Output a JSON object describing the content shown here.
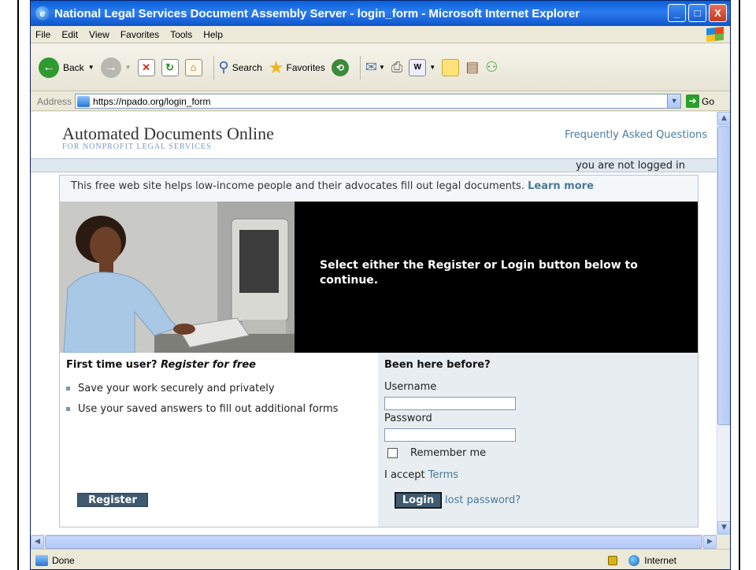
{
  "window": {
    "title": "National Legal Services Document Assembly Server - login_form - Microsoft Internet Explorer",
    "controls": [
      "_",
      "□",
      "X"
    ]
  },
  "menu": [
    "File",
    "Edit",
    "View",
    "Favorites",
    "Tools",
    "Help"
  ],
  "toolbar": {
    "back_label": "Back",
    "search_label": "Search",
    "favorites_label": "Favorites"
  },
  "address": {
    "label": "Address",
    "url": "https://npado.org/login_form",
    "go_label": "Go"
  },
  "site": {
    "title": "Automated Documents Online",
    "subtitle": "FOR NONPROFIT LEGAL SERVICES",
    "faq_link": "Frequently Asked Questions",
    "login_status": "you are not logged in",
    "intro_text": "This free web site helps low-income people and their advocates fill out legal documents.",
    "learn_more": "Learn more",
    "hero_message": "Select either the Register or Login button below to continue."
  },
  "register": {
    "heading_prefix": "First time user?",
    "heading_emph": "Register for free",
    "bullets": [
      "Save your work securely and privately",
      "Use your saved answers to fill out additional forms"
    ],
    "button": "Register"
  },
  "login": {
    "heading": "Been here before?",
    "username_label": "Username",
    "username_value": "",
    "password_label": "Password",
    "password_value": "",
    "remember_label": "Remember me",
    "remember_checked": false,
    "accept_prefix": "I accept",
    "terms_link": "Terms",
    "button": "Login",
    "lost_password": "lost password?"
  },
  "status": {
    "text": "Done",
    "zone": "Internet"
  },
  "icons": {
    "ie": "ie-logo-icon",
    "back": "back-arrow-icon",
    "forward": "forward-arrow-icon",
    "stop": "stop-icon",
    "refresh": "refresh-icon",
    "home": "home-icon",
    "search": "search-icon",
    "favorites": "favorites-star-icon",
    "history": "history-icon",
    "mail": "mail-icon",
    "print": "print-icon",
    "lock": "lock-icon",
    "globe": "globe-icon"
  },
  "colors": {
    "titlebar": "#0a5fd8",
    "button_bg": "#405a70",
    "link": "#4a7aa0"
  }
}
